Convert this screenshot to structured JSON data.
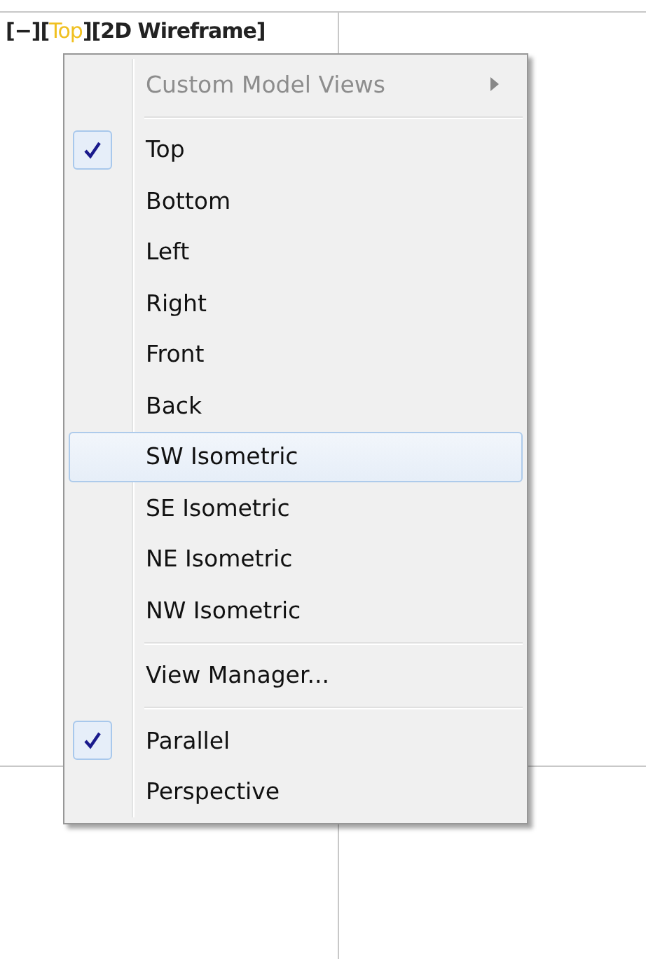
{
  "viewport_label": [
    {
      "text": "[−][",
      "highlighted": false
    },
    {
      "text": "Top",
      "highlighted": true
    },
    {
      "text": "][2D Wireframe]",
      "highlighted": false
    }
  ],
  "menu": {
    "items": [
      {
        "kind": "submenu",
        "label": "Custom Model Views",
        "disabled": true,
        "checked": false,
        "highlighted": false
      },
      {
        "kind": "separator"
      },
      {
        "kind": "item",
        "label": "Top",
        "disabled": false,
        "checked": true,
        "highlighted": false
      },
      {
        "kind": "item",
        "label": "Bottom",
        "disabled": false,
        "checked": false,
        "highlighted": false
      },
      {
        "kind": "item",
        "label": "Left",
        "disabled": false,
        "checked": false,
        "highlighted": false
      },
      {
        "kind": "item",
        "label": "Right",
        "disabled": false,
        "checked": false,
        "highlighted": false
      },
      {
        "kind": "item",
        "label": "Front",
        "disabled": false,
        "checked": false,
        "highlighted": false
      },
      {
        "kind": "item",
        "label": "Back",
        "disabled": false,
        "checked": false,
        "highlighted": false
      },
      {
        "kind": "item",
        "label": "SW Isometric",
        "disabled": false,
        "checked": false,
        "highlighted": true
      },
      {
        "kind": "item",
        "label": "SE Isometric",
        "disabled": false,
        "checked": false,
        "highlighted": false
      },
      {
        "kind": "item",
        "label": "NE Isometric",
        "disabled": false,
        "checked": false,
        "highlighted": false
      },
      {
        "kind": "item",
        "label": "NW Isometric",
        "disabled": false,
        "checked": false,
        "highlighted": false
      },
      {
        "kind": "separator"
      },
      {
        "kind": "item",
        "label": "View Manager...",
        "disabled": false,
        "checked": false,
        "highlighted": false
      },
      {
        "kind": "separator"
      },
      {
        "kind": "item",
        "label": "Parallel",
        "disabled": false,
        "checked": true,
        "highlighted": false
      },
      {
        "kind": "item",
        "label": "Perspective",
        "disabled": false,
        "checked": false,
        "highlighted": false
      }
    ]
  }
}
